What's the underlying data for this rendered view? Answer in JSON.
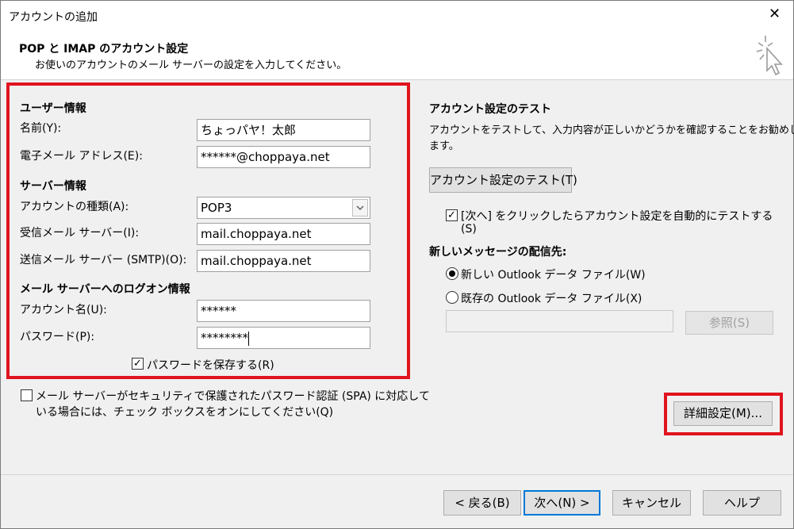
{
  "window": {
    "title": "アカウントの追加",
    "close_glyph": "✕"
  },
  "header": {
    "title": "POP と IMAP のアカウント設定",
    "subtitle": "お使いのアカウントのメール サーバーの設定を入力してください。",
    "icon": "cursor-sparkle-icon"
  },
  "user_info": {
    "heading": "ユーザー情報",
    "name_label": "名前(Y):",
    "name_value": "ちょっパヤ！太郎",
    "email_label": "電子メール アドレス(E):",
    "email_value": "******@choppaya.net"
  },
  "server_info": {
    "heading": "サーバー情報",
    "account_type_label": "アカウントの種類(A):",
    "account_type_value": "POP3",
    "incoming_label": "受信メール サーバー(I):",
    "incoming_value": "mail.choppaya.net",
    "outgoing_label": "送信メール サーバー (SMTP)(O):",
    "outgoing_value": "mail.choppaya.net"
  },
  "logon_info": {
    "heading": "メール サーバーへのログオン情報",
    "account_name_label": "アカウント名(U):",
    "account_name_value": "******",
    "password_label": "パスワード(P):",
    "password_value": "********",
    "save_password_label": "パスワードを保存する(R)",
    "save_password_checked": true
  },
  "spa": {
    "label_line1": "メール サーバーがセキュリティで保護されたパスワード認証 (SPA) に対応して",
    "label_line2": "いる場合には、チェック ボックスをオンにしてください(Q)",
    "checked": false
  },
  "test": {
    "heading": "アカウント設定のテスト",
    "desc_line1": "アカウントをテストして、入力内容が正しいかどうかを確認することをお勧めし",
    "desc_line2": "ます。",
    "button_label": "アカウント設定のテスト(T)",
    "auto_test_line1": "[次へ] をクリックしたらアカウント設定を自動的にテストする",
    "auto_test_line2": "(S)",
    "auto_test_checked": true
  },
  "delivery": {
    "heading": "新しいメッセージの配信先:",
    "new_file_label": "新しい Outlook データ ファイル(W)",
    "existing_file_label": "既存の Outlook データ ファイル(X)",
    "path_value": "",
    "browse_label": "参照(S)",
    "selected": "new"
  },
  "more_settings_label": "詳細設定(M)...",
  "footer": {
    "back_label": "< 戻る(B)",
    "next_label": "次へ(N) >",
    "cancel_label": "キャンセル",
    "help_label": "ヘルプ"
  },
  "colors": {
    "highlight_red": "#e0141e",
    "focus_blue": "#0078d7",
    "dialog_bg": "#f0f0f0"
  }
}
